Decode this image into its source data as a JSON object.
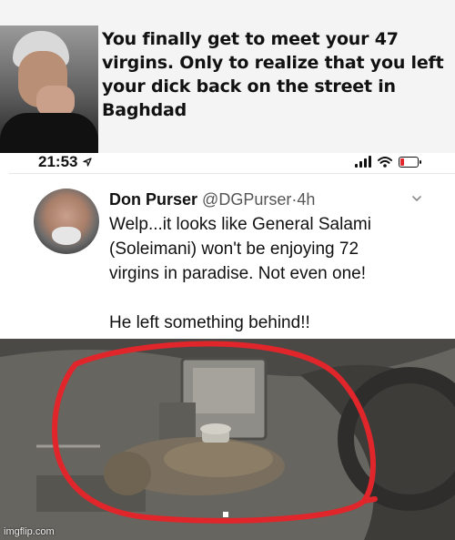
{
  "meme": {
    "caption": "You finally get to meet your 47\nvirgins. Only to realize that you left\nyour dick back on the street in\nBaghdad"
  },
  "status_bar": {
    "time": "21:53",
    "icons": [
      "location-arrow-icon",
      "signal-icon",
      "wifi-icon",
      "battery-low-icon"
    ],
    "battery_color": "#e0262b"
  },
  "tweet": {
    "display_name": "Don Purser",
    "handle": "@DGPurser",
    "separator": "·",
    "time": "4h",
    "text": "Welp...it looks like General Salami\n(Soleimani) won't be enjoying 72\nvirgins in paradise. Not even one!\n\nHe left something behind!!",
    "menu_icon": "chevron-down-icon"
  },
  "photo": {
    "annotation_color": "#e0262b",
    "watermark": "imgflip.com"
  }
}
